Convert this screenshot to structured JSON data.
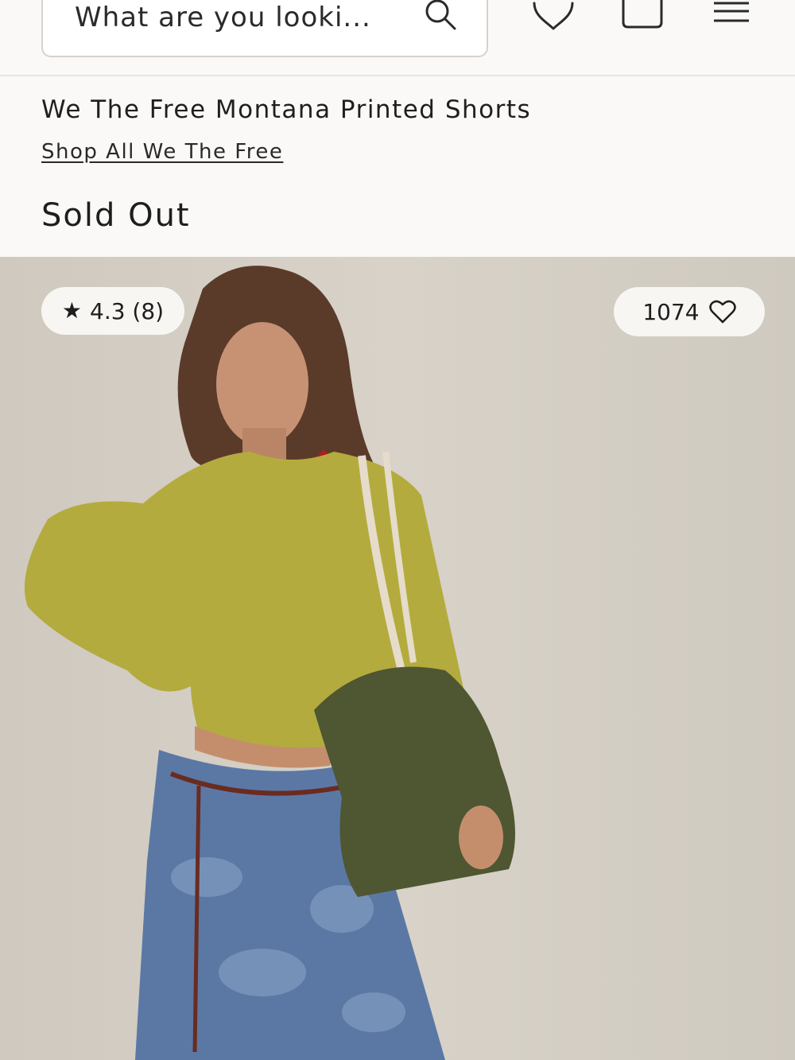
{
  "header": {
    "search": {
      "placeholder": "What are you looki..."
    },
    "icons": [
      "search-icon",
      "heart-icon",
      "bag-icon",
      "menu-icon"
    ]
  },
  "product": {
    "title": "We The Free Montana Printed Shorts",
    "shop_link": "Shop All We The Free",
    "status": "Sold Out"
  },
  "gallery": {
    "rating": "4.3 (8)",
    "likes": "1074",
    "image_description_icon": "product-photo"
  },
  "colors": {
    "background": "#faf9f7",
    "text": "#1e1e1e",
    "pill": "#f7f6f3"
  }
}
